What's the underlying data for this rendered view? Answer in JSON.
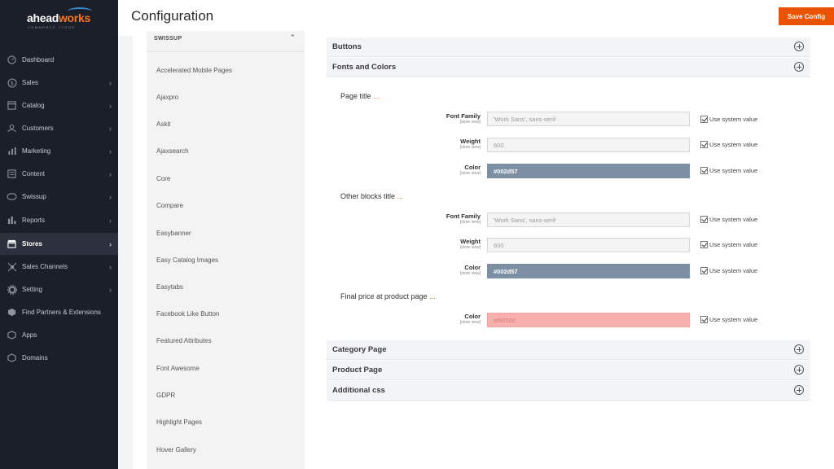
{
  "logo": {
    "main": "ahead",
    "accent": "works",
    "sub": "COMMERCE CLOUD"
  },
  "header": {
    "title": "Configuration",
    "save_label": "Save Config"
  },
  "sidebar": {
    "items": [
      {
        "label": "Dashboard",
        "icon": "dashboard-icon",
        "chevron": false
      },
      {
        "label": "Sales",
        "icon": "dollar-icon",
        "chevron": true
      },
      {
        "label": "Catalog",
        "icon": "catalog-icon",
        "chevron": true
      },
      {
        "label": "Customers",
        "icon": "customers-icon",
        "chevron": true
      },
      {
        "label": "Marketing",
        "icon": "marketing-icon",
        "chevron": true
      },
      {
        "label": "Content",
        "icon": "content-icon",
        "chevron": true
      },
      {
        "label": "Swissup",
        "icon": "swissup-icon",
        "chevron": true
      },
      {
        "label": "Reports",
        "icon": "reports-icon",
        "chevron": true
      },
      {
        "label": "Stores",
        "icon": "stores-icon",
        "chevron": true,
        "active": true
      },
      {
        "label": "Sales Channels",
        "icon": "sales-channels-icon",
        "chevron": true
      },
      {
        "label": "Setting",
        "icon": "gear-icon",
        "chevron": true
      },
      {
        "label": "Find Partners & Extensions",
        "icon": "partners-icon",
        "chevron": false
      },
      {
        "label": "Apps",
        "icon": "apps-icon",
        "chevron": false
      },
      {
        "label": "Domains",
        "icon": "domains-icon",
        "chevron": false
      }
    ]
  },
  "tabs": {
    "heading": "SWISSUP",
    "items": [
      "Accelerated Mobile Pages",
      "Ajaxpro",
      "Askit",
      "Ajaxsearch",
      "Core",
      "Compare",
      "Easybanner",
      "Easy Catalog Images",
      "Easytabs",
      "Facebook Like Button",
      "Featured Attributes",
      "Font Awesome",
      "GDPR",
      "Highlight Pages",
      "Hover Gallery"
    ]
  },
  "sections": {
    "buttons": "Buttons",
    "fonts_colors": "Fonts and Colors",
    "category_page": "Category Page",
    "product_page": "Product Page",
    "additional_css": "Additional css"
  },
  "groups": {
    "page_title": {
      "label": "Page title",
      "dots": "..."
    },
    "other_blocks": {
      "label": "Other blocks title",
      "dots": "..."
    },
    "final_price": {
      "label": "Final price at product page",
      "dots": "..."
    }
  },
  "fields": {
    "scope": "[store view]",
    "use_system_value": "Use system value",
    "pt_font_family": {
      "label": "Font Family",
      "value": "'Work Sans', sans-serif"
    },
    "pt_weight": {
      "label": "Weight",
      "value": "600"
    },
    "pt_color": {
      "label": "Color",
      "value": "#002d57"
    },
    "ob_font_family": {
      "label": "Font Family",
      "value": "'Work Sans', sans-serif"
    },
    "ob_weight": {
      "label": "Weight",
      "value": "600"
    },
    "ob_color": {
      "label": "Color",
      "value": "#002d57"
    },
    "fp_color": {
      "label": "Color",
      "value": "#f66560"
    }
  },
  "colors": {
    "accent": "#eb5202",
    "sidebar_bg": "#1b1f2a",
    "swatch_blue": "#7d8fa3",
    "swatch_pink": "#f7b0ae"
  }
}
